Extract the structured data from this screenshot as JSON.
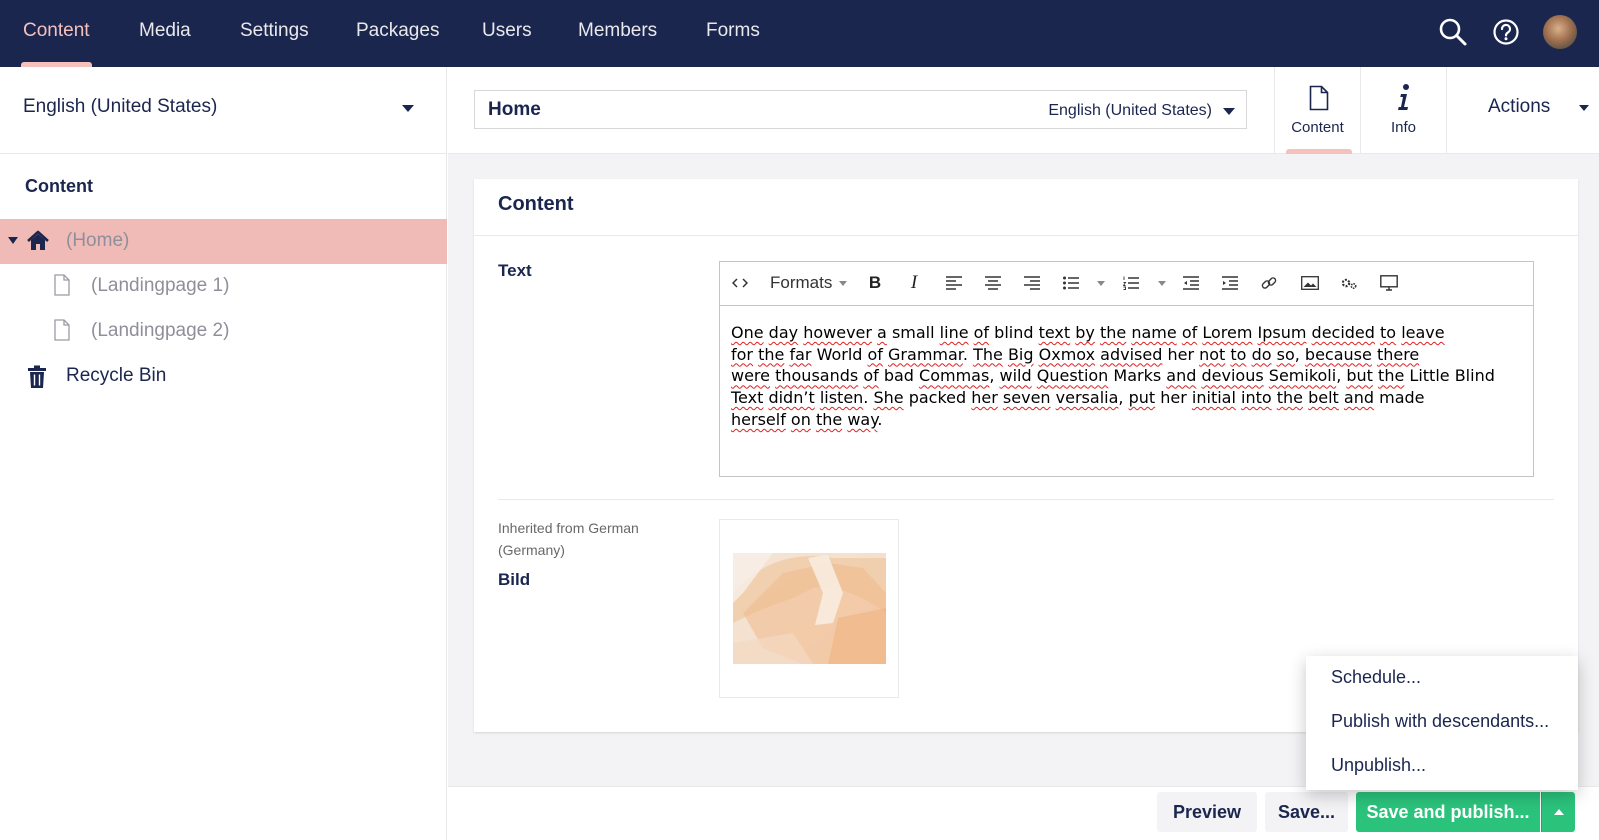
{
  "top_nav": {
    "items": [
      "Content",
      "Media",
      "Settings",
      "Packages",
      "Users",
      "Members",
      "Forms"
    ],
    "active": "Content",
    "icons": [
      "search-icon",
      "help-icon",
      "user-avatar"
    ]
  },
  "tree": {
    "language": "English (United States)",
    "section_title": "Content",
    "items": [
      {
        "label": "(Home)",
        "icon": "home-icon",
        "selected": true
      },
      {
        "label": "(Landingpage 1)",
        "icon": "document-icon"
      },
      {
        "label": "(Landingpage 2)",
        "icon": "document-icon"
      },
      {
        "label": "Recycle Bin",
        "icon": "trash-icon"
      }
    ]
  },
  "editor": {
    "name": "Home",
    "variant": "English (United States)",
    "apps": [
      {
        "label": "Content",
        "icon": "document-icon",
        "active": true
      },
      {
        "label": "Info",
        "icon": "info-icon"
      }
    ],
    "actions_label": "Actions"
  },
  "panel": {
    "title": "Content",
    "text_property": {
      "label": "Text",
      "toolbar": [
        "code-icon",
        "Formats",
        "bold-icon",
        "italic-icon",
        "align-left-icon",
        "align-center-icon",
        "align-right-icon",
        "bullet-list-icon",
        "numbered-list-icon",
        "outdent-icon",
        "indent-icon",
        "link-icon",
        "image-icon",
        "macro-icon",
        "embed-icon"
      ],
      "formats_label": "Formats",
      "content_words": [
        "One",
        "day",
        "however",
        "a",
        "small",
        "line",
        "of",
        "blind",
        "text",
        "by",
        "the",
        "name",
        "of",
        "Lorem",
        "Ipsum",
        "decided",
        "to",
        "leave",
        "for",
        "the",
        "far",
        "World",
        "of",
        "Grammar.",
        "The",
        "Big",
        "Oxmox",
        "advised",
        "her",
        "not",
        "to",
        "do",
        "so,",
        "because",
        "there",
        "were",
        "thousands",
        "of",
        "bad",
        "Commas,",
        "wild",
        "Question",
        "Marks",
        "and",
        "devious",
        "Semikoli,",
        "but",
        "the",
        "Little",
        "Blind",
        "Text",
        "didn’t",
        "listen.",
        "She",
        "packed",
        "her",
        "seven",
        "versalia,",
        "put",
        "her",
        "initial",
        "into",
        "the",
        "belt",
        "and",
        "made",
        "herself",
        "on",
        "the",
        "way."
      ]
    },
    "image_property": {
      "description": "Inherited from German (Germany)",
      "label": "Bild"
    }
  },
  "footer": {
    "preview": "Preview",
    "save": "Save...",
    "save_publish": "Save and publish..."
  },
  "publish_menu": {
    "items": [
      "Schedule...",
      "Publish with descendants...",
      "Unpublish..."
    ]
  },
  "colors": {
    "nav_bg": "#1b264f",
    "accent": "#f5c1bc",
    "selected_row": "#f0bbb6",
    "publish_green": "#2bc37c"
  }
}
